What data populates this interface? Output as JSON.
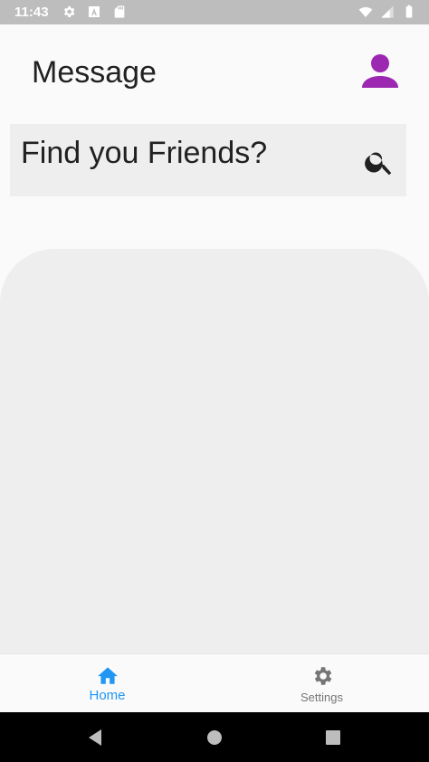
{
  "status_bar": {
    "time": "11:43",
    "left_icons": [
      "gear-icon",
      "font-a-icon",
      "sd-card-icon"
    ],
    "right_icons": [
      "wifi-icon",
      "signal-icon",
      "battery-icon"
    ]
  },
  "header": {
    "title": "Message",
    "profile_icon": "person-icon",
    "accent_color": "#9c27b0"
  },
  "search": {
    "placeholder": "Find you Friends?",
    "value": "",
    "icon": "search-icon"
  },
  "bottom_nav": {
    "items": [
      {
        "label": "Home",
        "icon": "home-icon",
        "active": true,
        "color": "#2196f3"
      },
      {
        "label": "Settings",
        "icon": "gear-icon",
        "active": false,
        "color": "#757575"
      }
    ]
  },
  "system_nav": {
    "buttons": [
      "back-icon",
      "home-circle-icon",
      "recents-icon"
    ]
  }
}
